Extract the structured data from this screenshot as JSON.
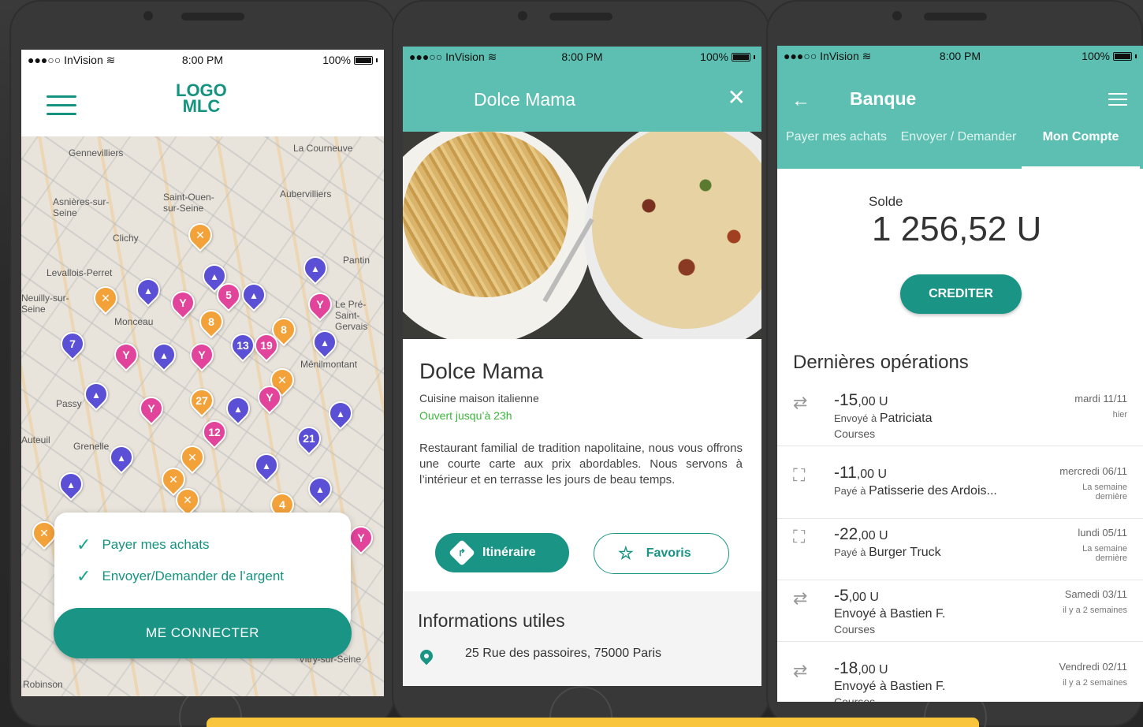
{
  "status": {
    "carrier": "●●●○○ InVision ≋",
    "time": "8:00 PM",
    "battery": "100%"
  },
  "screen1": {
    "logo_line1": "LOGO",
    "logo_line2": "MLC",
    "map_labels": [
      "Gennevilliers",
      "La Courneuve",
      "Asnières-sur-Seine",
      "Saint-Ouen-sur-Seine",
      "Aubervilliers",
      "Clichy",
      "Levallois-Perret",
      "Pantin",
      "Neuilly-sur-Seine",
      "Monceau",
      "Le Pré-Saint-Gervais",
      "Ménilmontant",
      "Passy",
      "Grenelle",
      "Auteuil",
      "Robinson",
      "Vitry-sur-Seine"
    ],
    "checks": [
      "Payer mes achats",
      "Envoyer/Demander de l’argent"
    ],
    "connect_label": "ME CONNECTER"
  },
  "screen2": {
    "title": "Dolce Mama",
    "close": "✕",
    "name": "Dolce Mama",
    "subtitle": "Cuisine maison italienne",
    "open": "Ouvert jusqu’à 23h",
    "description": "Restaurant familial de tradition napolitaine, nous vous offrons une courte carte aux prix abordables. Nous servons à l’intérieur et en terrasse les jours de beau temps.",
    "btn_itinerary": "Itinéraire",
    "btn_favoris": "Favoris",
    "info_title": "Informations utiles",
    "address": "25 Rue des passoires, 75000 Paris"
  },
  "screen3": {
    "title": "Banque",
    "tabs": [
      "Payer mes achats",
      "Envoyer / Demander",
      "Mon Compte"
    ],
    "solde_label": "Solde",
    "solde_value": "1 256,52  U",
    "crediter": "CREDITER",
    "ops_title": "Dernières opérations",
    "operations": [
      {
        "amount": "-15",
        "cents": ",00 U",
        "prefix": "Envoyé à ",
        "who": "Patriciata",
        "note": "Courses",
        "date": "mardi 11/11",
        "rel": "hier"
      },
      {
        "amount": "-11",
        "cents": ",00 U",
        "prefix": "Payé à ",
        "who": "Patisserie des Ardois...",
        "note": "",
        "date": "mercredi 06/11",
        "rel": "La semaine dernière"
      },
      {
        "amount": "-22",
        "cents": ",00 U",
        "prefix": "Payé à ",
        "who": "Burger Truck",
        "note": "",
        "date": "lundi 05/11",
        "rel": "La semaine dernière"
      },
      {
        "amount": "-5",
        "cents": ",00 U",
        "prefix": "Envoyé à ",
        "who": "Bastien F.",
        "note": "Courses",
        "date": "Samedi 03/11",
        "rel": "il y a 2 semaines"
      },
      {
        "amount": "-18",
        "cents": ",00 U",
        "prefix": "Envoyé à ",
        "who": "Bastien F.",
        "note": "Courses",
        "date": "Vendredi 02/11",
        "rel": "il y a 2 semaines"
      }
    ]
  },
  "colors": {
    "accent": "#1a9484",
    "header": "#5cbfb1",
    "open_green": "#3ab53a",
    "pin_purple": "#5b4fd6",
    "pin_pink": "#e2439b",
    "pin_orange": "#f3a23a",
    "highlight": "#f9c53d"
  },
  "icons": [
    "hamburger-icon",
    "check-icon",
    "close-icon",
    "directions-icon",
    "star-icon",
    "location-pin-icon",
    "back-arrow-icon",
    "menu-icon",
    "transfer-icon",
    "qr-scan-icon"
  ]
}
